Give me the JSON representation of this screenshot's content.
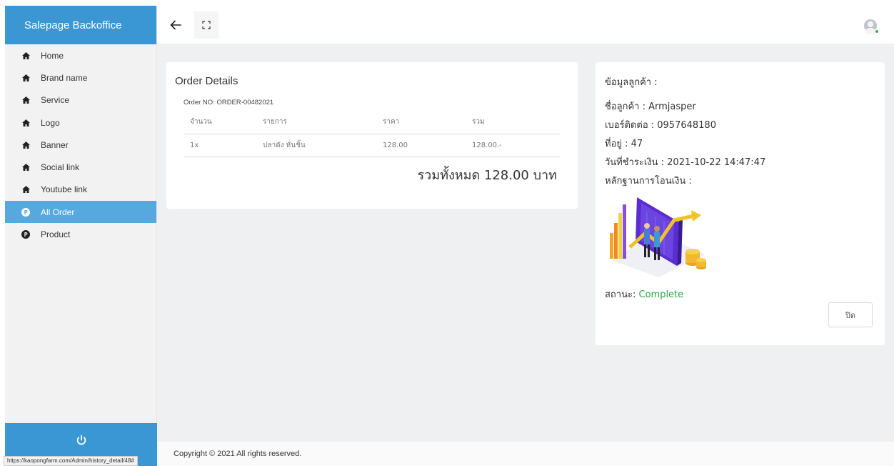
{
  "sidebar": {
    "brand": "Salepage Backoffice",
    "items": [
      {
        "label": "Home",
        "icon": "home-icon"
      },
      {
        "label": "Brand name",
        "icon": "home-icon"
      },
      {
        "label": "Service",
        "icon": "home-icon"
      },
      {
        "label": "Logo",
        "icon": "home-icon"
      },
      {
        "label": "Banner",
        "icon": "home-icon"
      },
      {
        "label": "Social link",
        "icon": "home-icon"
      },
      {
        "label": "Youtube link",
        "icon": "home-icon"
      },
      {
        "label": "All Order",
        "icon": "product-icon"
      },
      {
        "label": "Product",
        "icon": "product-icon"
      }
    ],
    "active_item": "All Order"
  },
  "order": {
    "title": "Order Details",
    "order_no": "Order NO: ORDER-00482021",
    "columns": [
      "จำนวน",
      "รายการ",
      "ราคา",
      "รวม"
    ],
    "rows": [
      {
        "qty": "1x",
        "item": "ปลาดัง หั่นชิ้น",
        "price": "128.00",
        "total": "128.00.-"
      }
    ],
    "grand_total": "รวมทั้งหมด 128.00 บาท"
  },
  "customer": {
    "heading": "ข้อมูลลูกค้า :",
    "name": "ชื่อลูกค้า : Armjasper",
    "phone": "เบอร์ติดต่อ : 0957648180",
    "address": "ที่อยู่ : 47",
    "paid_at": "วันที่ชำระเงิน : 2021-10-22 14:47:47",
    "proof_label": "หลักฐานการโอนเงิน :",
    "status_label": "สถานะ: ",
    "status_value": "Complete",
    "close_label": "ปิด"
  },
  "footer": {
    "copyright": "Copyright © 2021 All rights reserved."
  },
  "status_bar": {
    "url": "https://kaopongfarm.com/Admin/history_detail/48#"
  },
  "colors": {
    "brand": "#3a97d4",
    "active": "#55a9de",
    "status_complete": "#28a745"
  }
}
